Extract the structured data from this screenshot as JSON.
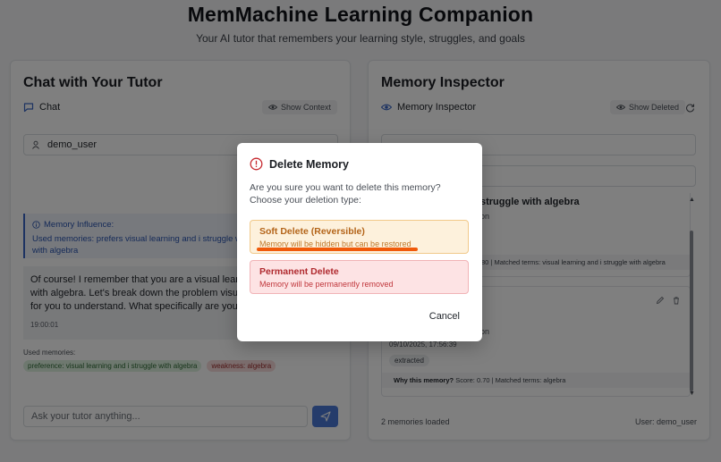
{
  "header": {
    "title": "MemMachine Learning Companion",
    "subtitle": "Your AI tutor that remembers your learning style, struggles, and goals"
  },
  "chat_panel": {
    "title": "Chat with Your Tutor",
    "section_label": "Chat",
    "show_context_label": "Show Context",
    "user_value": "demo_user",
    "influence_label": "Memory Influence:",
    "influence_text": "Used memories: prefers visual learning and i struggle with algebra; struggles with algebra",
    "message_text": "Of course! I remember that you are a visual learner who struggles with algebra. Let's break down the problem visually to make it easier for you to understand. What specifically are you having trouble with?",
    "message_time": "19:00:01",
    "used_memories_label": "Used memories:",
    "used_tags": [
      {
        "label": "preference: visual learning and i struggle with algebra",
        "kind": "green"
      },
      {
        "label": "weakness: algebra",
        "kind": "red"
      }
    ],
    "input_placeholder": "Ask your tutor anything..."
  },
  "memory_panel": {
    "title": "Memory Inspector",
    "section_label": "Memory Inspector",
    "show_deleted_label": "Show Deleted",
    "cards": [
      {
        "title_fragment": "struggle with algebra",
        "meta_fragment": "on",
        "why_fragment": "80 | Matched terms: visual learning and i struggle with algebra"
      },
      {
        "meta_fragment": "on",
        "date": "09/10/2025, 17:56:39",
        "source": "extracted",
        "why_label": "Why this memory?",
        "why_text": "Score: 0.70 | Matched terms: algebra"
      }
    ],
    "footer_count": "2 memories loaded",
    "footer_user": "User: demo_user"
  },
  "modal": {
    "title": "Delete Memory",
    "description": "Are you sure you want to delete this memory? Choose your deletion type:",
    "soft_title": "Soft Delete (Reversible)",
    "soft_desc": "Memory will be hidden but can be restored",
    "perm_title": "Permanent Delete",
    "perm_desc": "Memory will be permanently removed",
    "cancel_label": "Cancel"
  },
  "colors": {
    "accent": "#4a78d6",
    "warning_bg": "#fdf1dc",
    "danger_bg": "#fde3e4",
    "annotation": "#f05a0a"
  }
}
